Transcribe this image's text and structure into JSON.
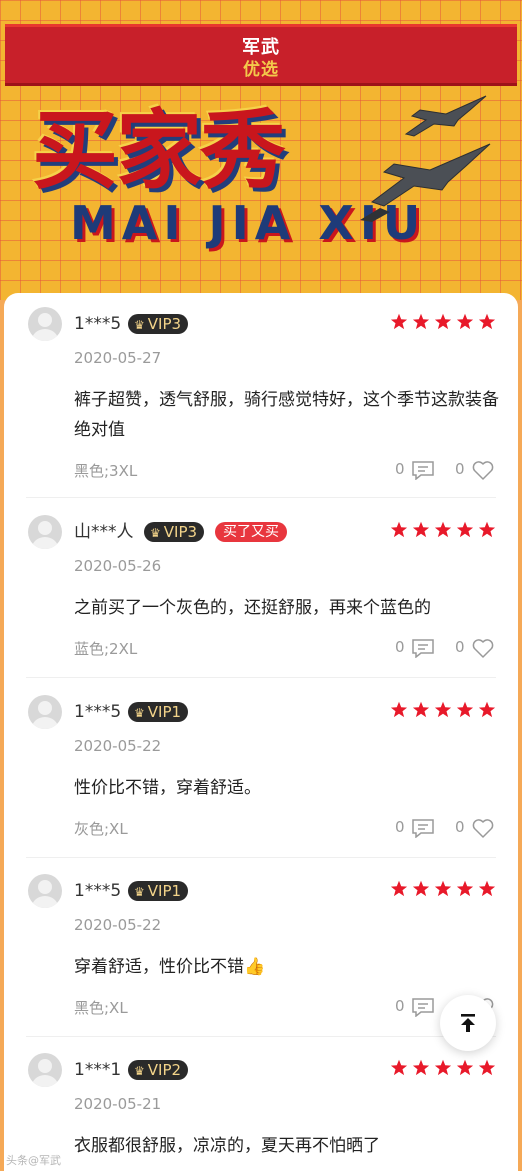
{
  "banner": {
    "logo_line1": "军武",
    "logo_line2": "优选",
    "title_cn": "买家秀",
    "title_en": "MAI JIA XIU"
  },
  "reviews": [
    {
      "user": "1***5",
      "vip": "VIP3",
      "badge": null,
      "rating": 5,
      "date": "2020-05-27",
      "text": "裤子超赞，透气舒服，骑行感觉特好，这个季节这款装备绝对值",
      "spec": "黑色;3XL",
      "comments": "0",
      "likes": "0"
    },
    {
      "user": "山***人",
      "vip": "VIP3",
      "badge": "买了又买",
      "rating": 5,
      "date": "2020-05-26",
      "text": "之前买了一个灰色的，还挺舒服，再来个蓝色的",
      "spec": "蓝色;2XL",
      "comments": "0",
      "likes": "0"
    },
    {
      "user": "1***5",
      "vip": "VIP1",
      "badge": null,
      "rating": 5,
      "date": "2020-05-22",
      "text": "性价比不错，穿着舒适。",
      "spec": "灰色;XL",
      "comments": "0",
      "likes": "0"
    },
    {
      "user": "1***5",
      "vip": "VIP1",
      "badge": null,
      "rating": 5,
      "date": "2020-05-22",
      "text": "穿着舒适，性价比不错👍",
      "spec": "黑色;XL",
      "comments": "0",
      "likes": "0"
    },
    {
      "user": "1***1",
      "vip": "VIP2",
      "badge": null,
      "rating": 5,
      "date": "2020-05-21",
      "text": "衣服都很舒服，凉凉的，夏天再不怕晒了",
      "spec": "",
      "comments": "",
      "likes": ""
    }
  ],
  "watermark": "头条@军武",
  "colors": {
    "star": "#E8192A",
    "vip_bg": "#2A2A2A",
    "vip_text": "#F3D48A",
    "rebuy_bg": "#E8363E",
    "banner_bg": "#F3B531",
    "page_bg": "#F5A957"
  }
}
